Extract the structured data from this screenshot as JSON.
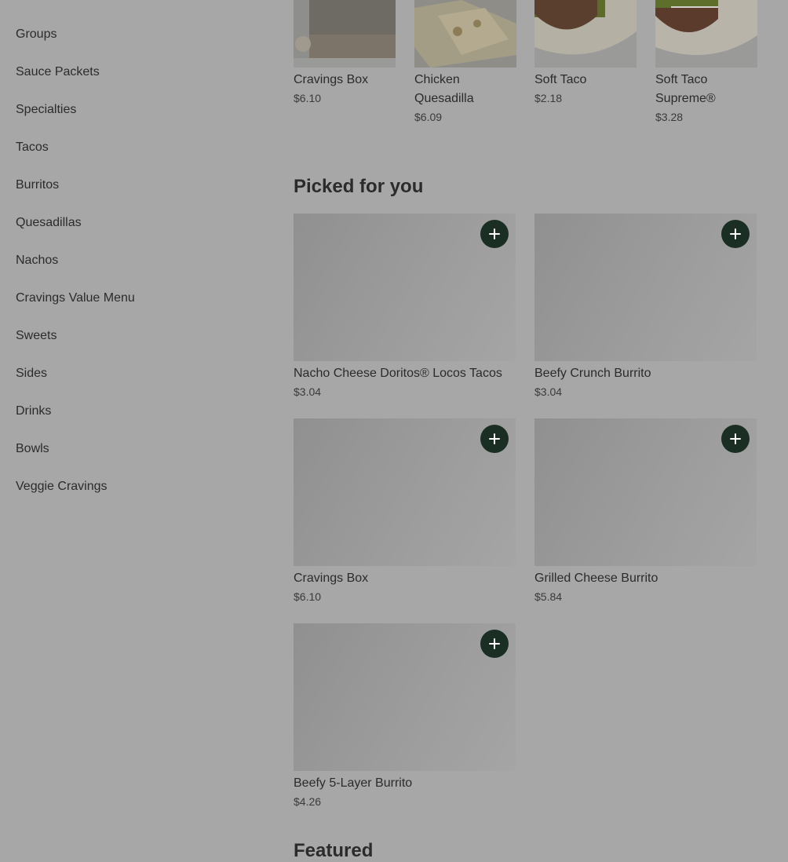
{
  "sidebar": {
    "items": [
      {
        "label": "Groups"
      },
      {
        "label": "Sauce Packets"
      },
      {
        "label": "Specialties"
      },
      {
        "label": "Tacos"
      },
      {
        "label": "Burritos"
      },
      {
        "label": "Quesadillas"
      },
      {
        "label": "Nachos"
      },
      {
        "label": "Cravings Value Menu"
      },
      {
        "label": "Sweets"
      },
      {
        "label": "Sides"
      },
      {
        "label": "Drinks"
      },
      {
        "label": "Bowls"
      },
      {
        "label": "Veggie Cravings"
      }
    ]
  },
  "top_row": [
    {
      "name": "Cravings Box",
      "price": "$6.10"
    },
    {
      "name": "Chicken Quesadilla",
      "price": "$6.09"
    },
    {
      "name": "Soft Taco",
      "price": "$2.18"
    },
    {
      "name": "Soft Taco Supreme®",
      "price": "$3.28"
    }
  ],
  "picked": {
    "title": "Picked for you",
    "items": [
      {
        "name": "Nacho Cheese Doritos® Locos Tacos",
        "price": "$3.04"
      },
      {
        "name": "Beefy Crunch Burrito",
        "price": "$3.04"
      },
      {
        "name": "Cravings Box",
        "price": "$6.10"
      },
      {
        "name": "Grilled Cheese Burrito",
        "price": "$5.84"
      },
      {
        "name": "Beefy 5-Layer Burrito",
        "price": "$4.26"
      }
    ]
  },
  "next_section": {
    "title": "Featured"
  },
  "icons": {
    "add": "plus-icon"
  },
  "colors": {
    "add_button": "#1b2e24",
    "overlay_bg": "#a7a7a7"
  }
}
